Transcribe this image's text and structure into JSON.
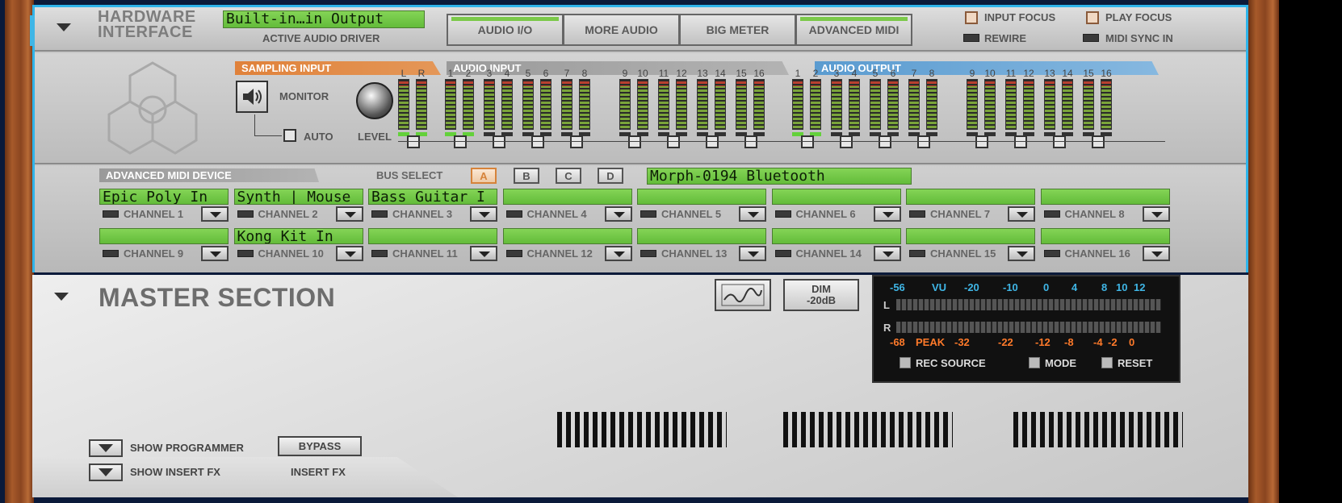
{
  "hardware_interface": {
    "title_line1": "HARDWARE",
    "title_line2": "INTERFACE",
    "driver_value": "Built-in…in Output",
    "driver_label": "ACTIVE AUDIO DRIVER",
    "tabs": [
      {
        "label": "AUDIO I/O"
      },
      {
        "label": "MORE AUDIO"
      },
      {
        "label": "BIG METER"
      },
      {
        "label": "ADVANCED MIDI"
      }
    ],
    "input_focus": "INPUT FOCUS",
    "play_focus": "PLAY FOCUS",
    "rewire": "REWIRE",
    "midi_sync_in": "MIDI SYNC IN"
  },
  "sampling": {
    "banner": "SAMPLING INPUT",
    "monitor": "MONITOR",
    "auto": "AUTO",
    "level": "LEVEL"
  },
  "audio_input": {
    "banner": "AUDIO INPUT",
    "lr": [
      "L",
      "R"
    ],
    "channels": [
      "1",
      "2",
      "3",
      "4",
      "5",
      "6",
      "7",
      "8",
      "9",
      "10",
      "11",
      "12",
      "13",
      "14",
      "15",
      "16"
    ]
  },
  "audio_output": {
    "banner": "AUDIO OUTPUT",
    "channels": [
      "1",
      "2",
      "3",
      "4",
      "5",
      "6",
      "7",
      "8",
      "9",
      "10",
      "11",
      "12",
      "13",
      "14",
      "15",
      "16"
    ]
  },
  "advanced_midi": {
    "banner": "ADVANCED MIDI DEVICE",
    "bus_select": "BUS SELECT",
    "buses": [
      "A",
      "B",
      "C",
      "D"
    ],
    "active_bus": "A",
    "device_name": "Morph-0194 Bluetooth",
    "channels": [
      {
        "label": "CHANNEL 1",
        "device": "Epic Poly In"
      },
      {
        "label": "CHANNEL 2",
        "device": "Synth | Mouse"
      },
      {
        "label": "CHANNEL 3",
        "device": "Bass Guitar I"
      },
      {
        "label": "CHANNEL 4",
        "device": ""
      },
      {
        "label": "CHANNEL 5",
        "device": ""
      },
      {
        "label": "CHANNEL 6",
        "device": ""
      },
      {
        "label": "CHANNEL 7",
        "device": ""
      },
      {
        "label": "CHANNEL 8",
        "device": ""
      },
      {
        "label": "CHANNEL 9",
        "device": ""
      },
      {
        "label": "CHANNEL 10",
        "device": "Kong Kit In"
      },
      {
        "label": "CHANNEL 11",
        "device": ""
      },
      {
        "label": "CHANNEL 12",
        "device": ""
      },
      {
        "label": "CHANNEL 13",
        "device": ""
      },
      {
        "label": "CHANNEL 14",
        "device": ""
      },
      {
        "label": "CHANNEL 15",
        "device": ""
      },
      {
        "label": "CHANNEL 16",
        "device": ""
      }
    ]
  },
  "master_section": {
    "title": "MASTER SECTION",
    "dim_label": "DIM\n-20dB",
    "vu_scale": [
      "-56",
      "VU",
      "-20",
      "-10",
      "0",
      "4",
      "8",
      "10",
      "12"
    ],
    "peak_scale": [
      "-68",
      "PEAK",
      "-32",
      "-22",
      "-12",
      "-8",
      "-4",
      "-2",
      "0"
    ],
    "channel_l": "L",
    "channel_r": "R",
    "rec_source": "REC SOURCE",
    "mode": "MODE",
    "reset": "RESET",
    "show_programmer": "SHOW PROGRAMMER",
    "show_insert_fx": "SHOW INSERT FX",
    "bypass": "BYPASS",
    "insert_fx": "INSERT FX"
  },
  "colors": {
    "selection_border": "#2fb4ea",
    "lcd_green": "#6fc444",
    "sampling_banner": "#e0813a",
    "audio_output_banner": "#5a9bd0",
    "vu_scale_color": "#3fb6e6",
    "peak_scale_color": "#ff7a2a"
  }
}
